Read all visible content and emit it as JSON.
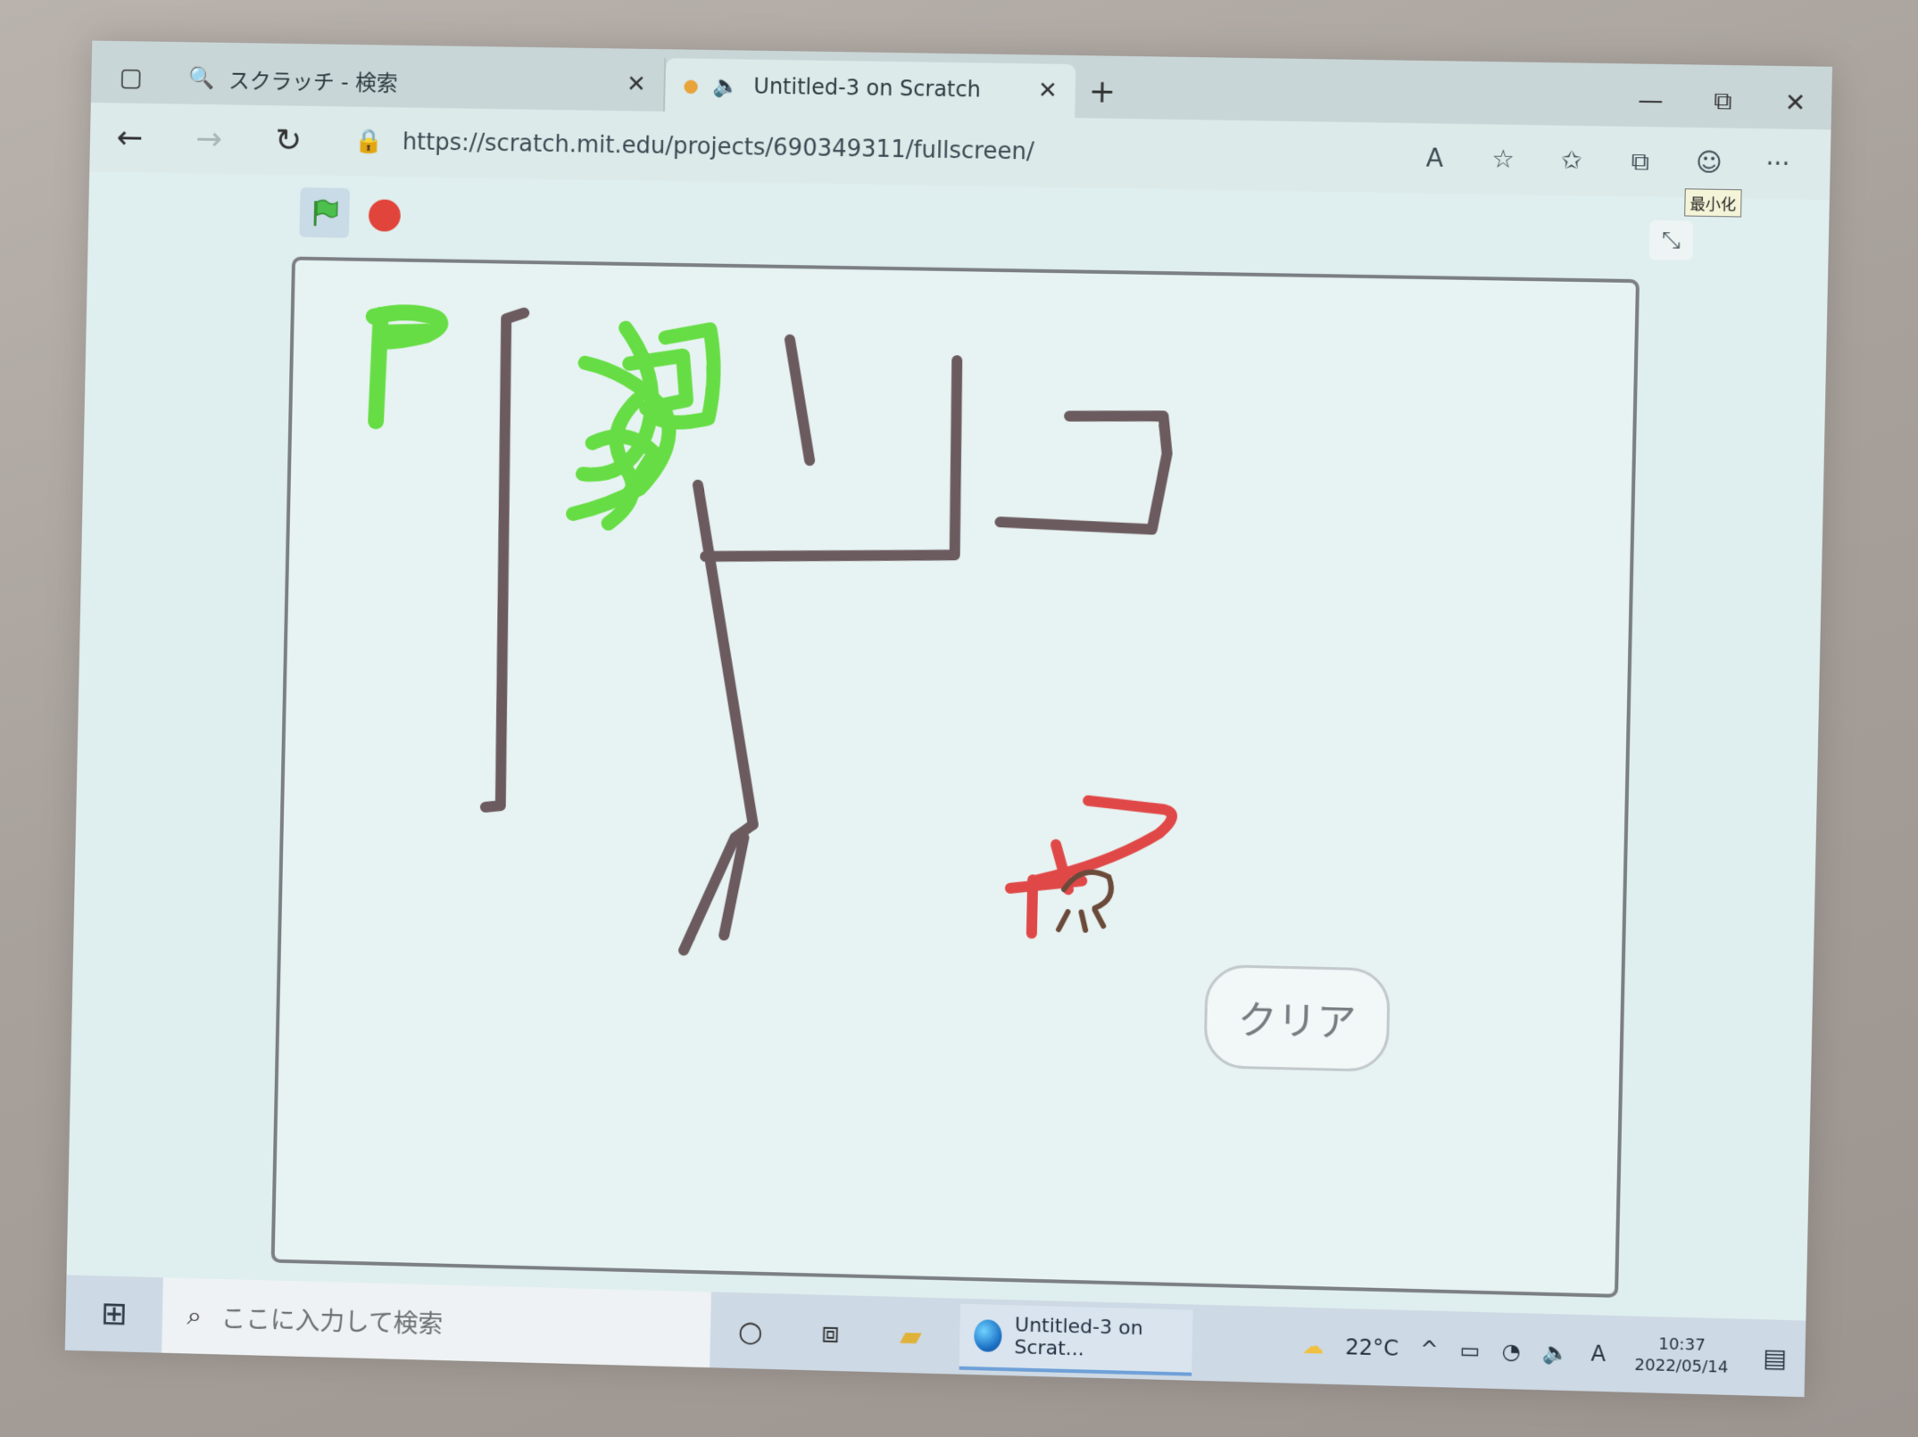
{
  "browser": {
    "tabs": [
      {
        "label": "スクラッチ - 検索",
        "icon": "search-icon"
      },
      {
        "label": "Untitled-3 on Scratch",
        "icon": "speaker-icon"
      }
    ],
    "url": "https://scratch.mit.edu/projects/690349311/fullscreen/",
    "tooltip": "最小化"
  },
  "icons": {
    "sidebar": "▢",
    "search": "🔍",
    "speaker": "🔈",
    "close": "✕",
    "new_tab": "+",
    "minimize": "—",
    "restore": "⧉",
    "back": "←",
    "forward": "→",
    "refresh": "↻",
    "lock": "🔒",
    "read_aloud": "A",
    "add_favorite": "☆",
    "favorites": "✩",
    "collections": "⧉",
    "profile": "☺",
    "more": "···",
    "fullscreen_exit": "⤡",
    "windows": "⊞",
    "task_search": "⌕",
    "cortana": "○",
    "task_view": "⧈",
    "explorer": "▰",
    "weather": "☁",
    "chevron_up": "^",
    "battery": "▭",
    "wifi": "◔",
    "volume": "🔈",
    "ime": "A",
    "notification": "▤"
  },
  "stage": {
    "speech_bubble": "クリア"
  },
  "taskbar": {
    "search_placeholder": "ここに入力して検索",
    "active_app": "Untitled-3 on Scrat...",
    "temperature": "22°C",
    "time": "10:37",
    "date": "2022/05/14"
  },
  "colors": {
    "pen_dark": "#6b5a5e",
    "pen_green": "#66dd44",
    "pen_red": "#e04848",
    "stop_red": "#e0443a",
    "flag_green": "#4cbf4c"
  }
}
